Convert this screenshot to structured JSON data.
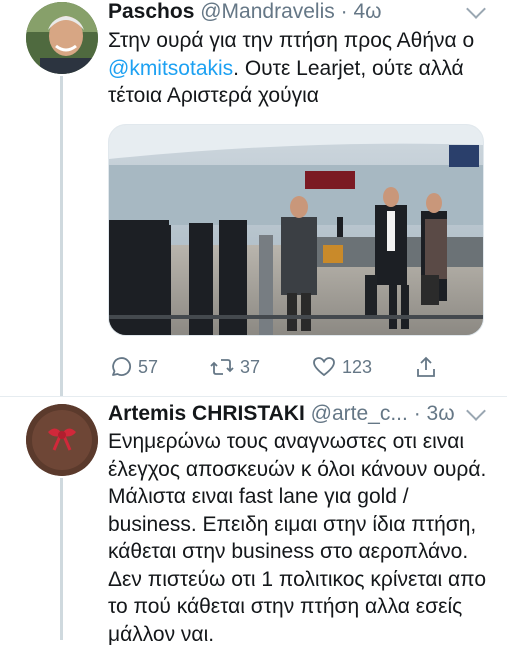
{
  "tweets": [
    {
      "name": "Paschos",
      "handle": "@Mandravelis",
      "dot": "·",
      "time": "4ω",
      "text_before": "Στην ουρά για την πτήση προς Αθήνα ο ",
      "mention": "@kmitsotakis",
      "text_after": ". Ουτε Learjet, ούτε αλλά τέτοια Αριστερά χούγια",
      "media": "airport-check-in-photo",
      "actions": {
        "reply_count": "57",
        "retweet_count": "37",
        "like_count": "123"
      }
    },
    {
      "name": "Artemis CHRISTAKI",
      "handle": "@arte_c...",
      "dot": "·",
      "time": "3ω",
      "text": "Ενημερώνω τους αναγνωστες οτι ειναι έλεγχος αποσκευών κ όλοι κάνουν ουρά. Μάλιστα ειναι fast lane για gold / business. Επειδη ειμαι στην ίδια πτήση, κάθεται στην business στο αεροπλάνο. Δεν πιστεύω οτι 1 πολιτικος κρίνεται απο το πού κάθεται στην πτήση αλλα εσείς μάλλον ναι."
    }
  ],
  "colors": {
    "link": "#1da1f2",
    "muted": "#657786",
    "thread": "#cfd9de"
  },
  "icons": [
    "reply-icon",
    "retweet-icon",
    "like-icon",
    "share-icon",
    "chevron-down-icon"
  ]
}
